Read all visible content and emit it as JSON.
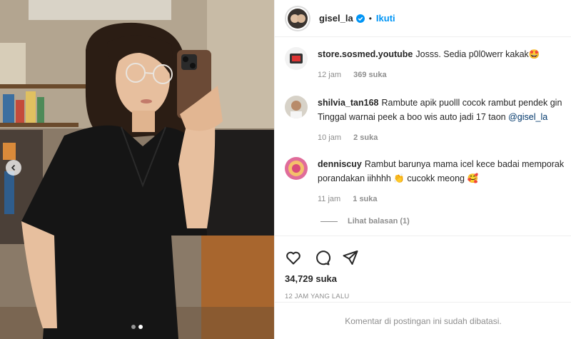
{
  "post": {
    "username": "gisel_la",
    "separator": "•",
    "follow_label": "Ikuti",
    "likes_total": "34,729 suka",
    "timestamp": "12 JAM YANG LALU",
    "comments_closed": "Komentar di postingan ini sudah dibatasi."
  },
  "comments": [
    {
      "user": "store.sosmed.youtube",
      "text": "Josss. Sedia p0l0werr kakak🤩",
      "time": "12 jam",
      "likes": "369 suka"
    },
    {
      "user": "shilvia_tan168",
      "text_line1": "Rambute apik puolll cocok rambut pendek gin",
      "text_line2": "Tinggal warnai peek a boo wis auto jadi 17 taon",
      "mention": "@gisel_la",
      "time": "10 jam",
      "likes": "2 suka"
    },
    {
      "user": "denniscuy",
      "text_line1": "Rambut barunya mama icel kece badai memporak",
      "text_line2": "porandakan iihhhh 👏 cucokk meong 🥰",
      "time": "11 jam",
      "likes": "1 suka"
    }
  ],
  "replies_label": "Lihat balasan (1)",
  "icons": {
    "like": "heart-icon",
    "comment": "comment-icon",
    "share": "paper-plane-icon",
    "verified": "verified-badge-icon",
    "carousel": "chevron-left-icon"
  },
  "colors": {
    "accent": "#0095f6",
    "muted": "#8e8e8e",
    "text": "#262626",
    "border": "#efefef"
  },
  "carousel": {
    "slides": 2,
    "active": 2
  }
}
